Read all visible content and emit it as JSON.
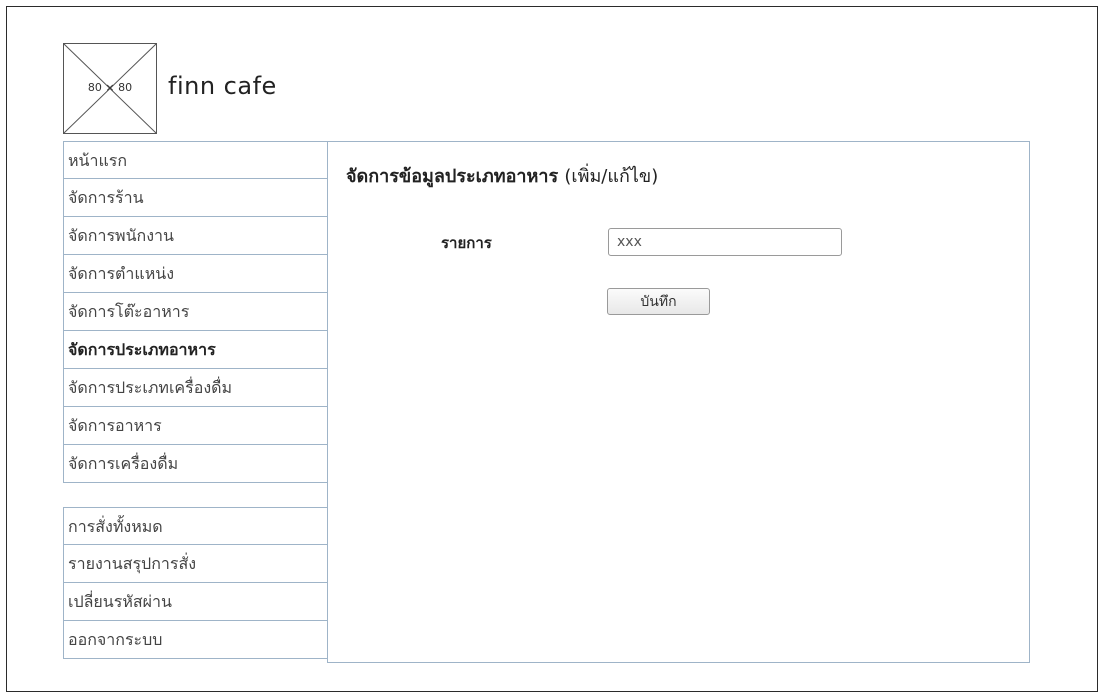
{
  "brand": {
    "logo_placeholder": "80 × 80",
    "name": "finn cafe"
  },
  "menu_main": [
    {
      "label": "หน้าแรก",
      "active": false
    },
    {
      "label": "จัดการร้าน",
      "active": false
    },
    {
      "label": "จัดการพนักงาน",
      "active": false
    },
    {
      "label": "จัดการตำแหน่ง",
      "active": false
    },
    {
      "label": "จัดการโต๊ะอาหาร",
      "active": false
    },
    {
      "label": "จัดการประเภทอาหาร",
      "active": true
    },
    {
      "label": "จัดการประเภทเครื่องดื่ม",
      "active": false
    },
    {
      "label": "จัดการอาหาร",
      "active": false
    },
    {
      "label": "จัดการเครื่องดื่ม",
      "active": false
    }
  ],
  "menu_secondary": [
    {
      "label": "การสั่งทั้งหมด"
    },
    {
      "label": "รายงานสรุปการสั่ง"
    },
    {
      "label": "เปลี่ยนรหัสผ่าน"
    },
    {
      "label": "ออกจากระบบ"
    }
  ],
  "form": {
    "title": "จัดการข้อมูลประเภทอาหาร",
    "title_suffix": "(เพิ่ม/แก้ไข)",
    "field_label": "รายการ",
    "field_value": "xxx",
    "save_label": "บันทึก"
  }
}
